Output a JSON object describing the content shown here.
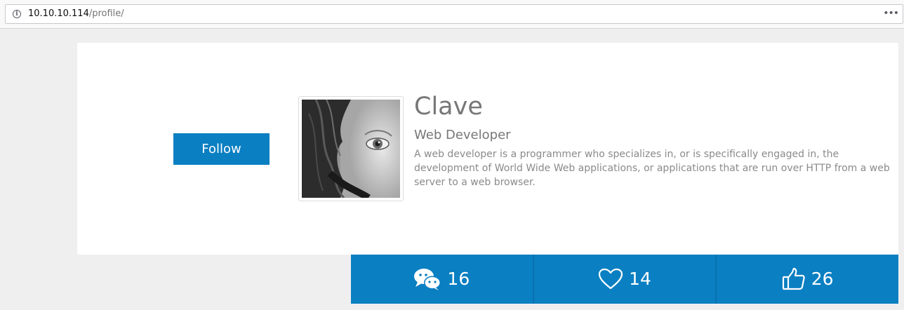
{
  "browser": {
    "url_host": "10.10.10.114",
    "url_path": "/profile/",
    "menu_glyph": "•••"
  },
  "profile": {
    "follow_label": "Follow",
    "name": "Clave",
    "role": "Web Developer",
    "bio": "A web developer is a programmer who specializes in, or is specifically engaged in, the development of World Wide Web applications, or applications that are run over HTTP from a web server to a web browser.",
    "avatar": "grayscale-face-photo"
  },
  "stats": [
    {
      "icon": "chat-bubbles-icon",
      "count": "16"
    },
    {
      "icon": "heart-icon",
      "count": "14"
    },
    {
      "icon": "thumbs-up-icon",
      "count": "26"
    }
  ],
  "colors": {
    "accent": "#0a7fc2",
    "background": "#efefef",
    "card": "#ffffff",
    "text_muted": "#777777"
  }
}
